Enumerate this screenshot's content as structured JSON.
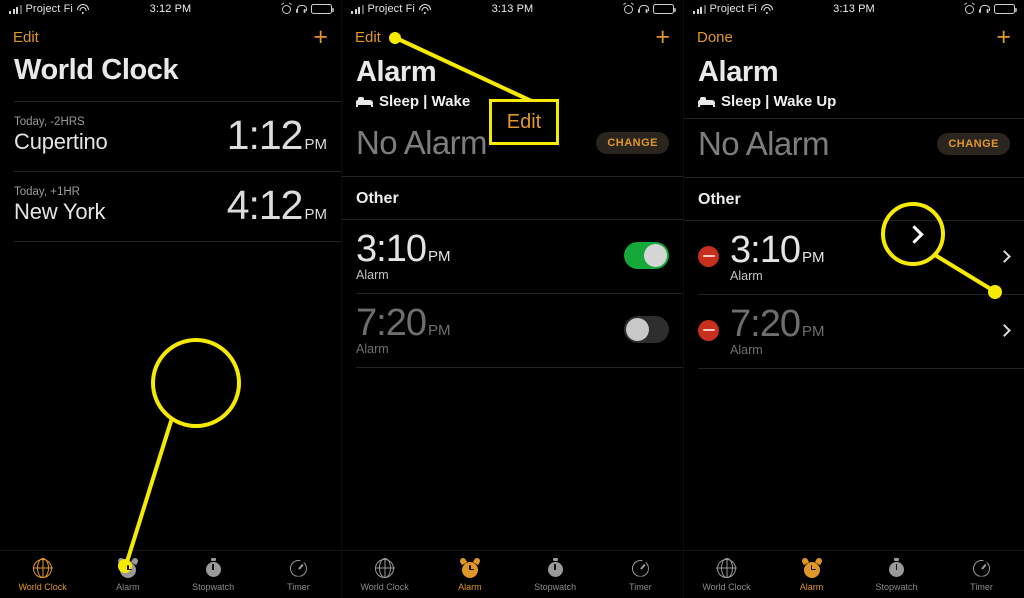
{
  "colors": {
    "accent_orange": "#e0972a",
    "annotation_yellow": "#f5ea00",
    "toggle_on_green": "#14a93a",
    "delete_red": "#c7301f",
    "background": "#000000"
  },
  "panels": [
    {
      "id": "world-clock",
      "statusbar": {
        "carrier": "Project Fi",
        "time": "3:12 PM",
        "icons": [
          "signal-bars-icon",
          "wifi-icon",
          "alarm-status-icon",
          "headphones-icon",
          "battery-icon"
        ]
      },
      "navbar": {
        "left_action": "Edit",
        "right_action": "+"
      },
      "title": "World Clock",
      "clocks": [
        {
          "subtitle": "Today, -2HRS",
          "city": "Cupertino",
          "time": "1:12",
          "meridiem": "PM"
        },
        {
          "subtitle": "Today, +1HR",
          "city": "New York",
          "time": "4:12",
          "meridiem": "PM"
        }
      ],
      "tabs": [
        {
          "label": "World Clock",
          "icon": "globe-icon",
          "active": true
        },
        {
          "label": "Alarm",
          "icon": "alarm-clock-icon",
          "active": false
        },
        {
          "label": "Stopwatch",
          "icon": "stopwatch-icon",
          "active": false
        },
        {
          "label": "Timer",
          "icon": "timer-icon",
          "active": false
        }
      ]
    },
    {
      "id": "alarm-list",
      "statusbar": {
        "carrier": "Project Fi",
        "time": "3:13 PM"
      },
      "navbar": {
        "left_action": "Edit",
        "right_action": "+"
      },
      "title": "Alarm",
      "sleep_wake": {
        "label": "Sleep | Wake",
        "icon": "bed-icon"
      },
      "no_alarm": {
        "text": "No Alarm",
        "button": "CHANGE"
      },
      "section": "Other",
      "alarms": [
        {
          "time": "3:10",
          "meridiem": "PM",
          "label": "Alarm",
          "enabled": true
        },
        {
          "time": "7:20",
          "meridiem": "PM",
          "label": "Alarm",
          "enabled": false
        }
      ],
      "tabs": [
        {
          "label": "World Clock",
          "icon": "globe-icon",
          "active": false
        },
        {
          "label": "Alarm",
          "icon": "alarm-clock-icon",
          "active": true
        },
        {
          "label": "Stopwatch",
          "icon": "stopwatch-icon",
          "active": false
        },
        {
          "label": "Timer",
          "icon": "timer-icon",
          "active": false
        }
      ]
    },
    {
      "id": "alarm-edit",
      "statusbar": {
        "carrier": "Project Fi",
        "time": "3:13 PM"
      },
      "navbar": {
        "left_action": "Done",
        "right_action": "+"
      },
      "title": "Alarm",
      "sleep_wake": {
        "label": "Sleep | Wake Up",
        "icon": "bed-icon"
      },
      "no_alarm": {
        "text": "No Alarm",
        "button": "CHANGE"
      },
      "section": "Other",
      "alarms": [
        {
          "time": "3:10",
          "meridiem": "PM",
          "label": "Alarm",
          "delete": "delete-icon",
          "chevron": "chevron-right-icon"
        },
        {
          "time": "7:20",
          "meridiem": "PM",
          "label": "Alarm",
          "delete": "delete-icon",
          "chevron": "chevron-right-icon"
        }
      ],
      "tabs": [
        {
          "label": "World Clock",
          "icon": "globe-icon",
          "active": false
        },
        {
          "label": "Alarm",
          "icon": "alarm-clock-icon",
          "active": true
        },
        {
          "label": "Stopwatch",
          "icon": "stopwatch-icon",
          "active": false
        },
        {
          "label": "Timer",
          "icon": "timer-icon",
          "active": false
        }
      ]
    }
  ],
  "annotations": {
    "circle_alarm_tab": {
      "target": "Alarm tab icon"
    },
    "edit_callout": {
      "label": "Edit"
    },
    "magnifier_chevron": {
      "target": "chevron-right-icon"
    }
  }
}
